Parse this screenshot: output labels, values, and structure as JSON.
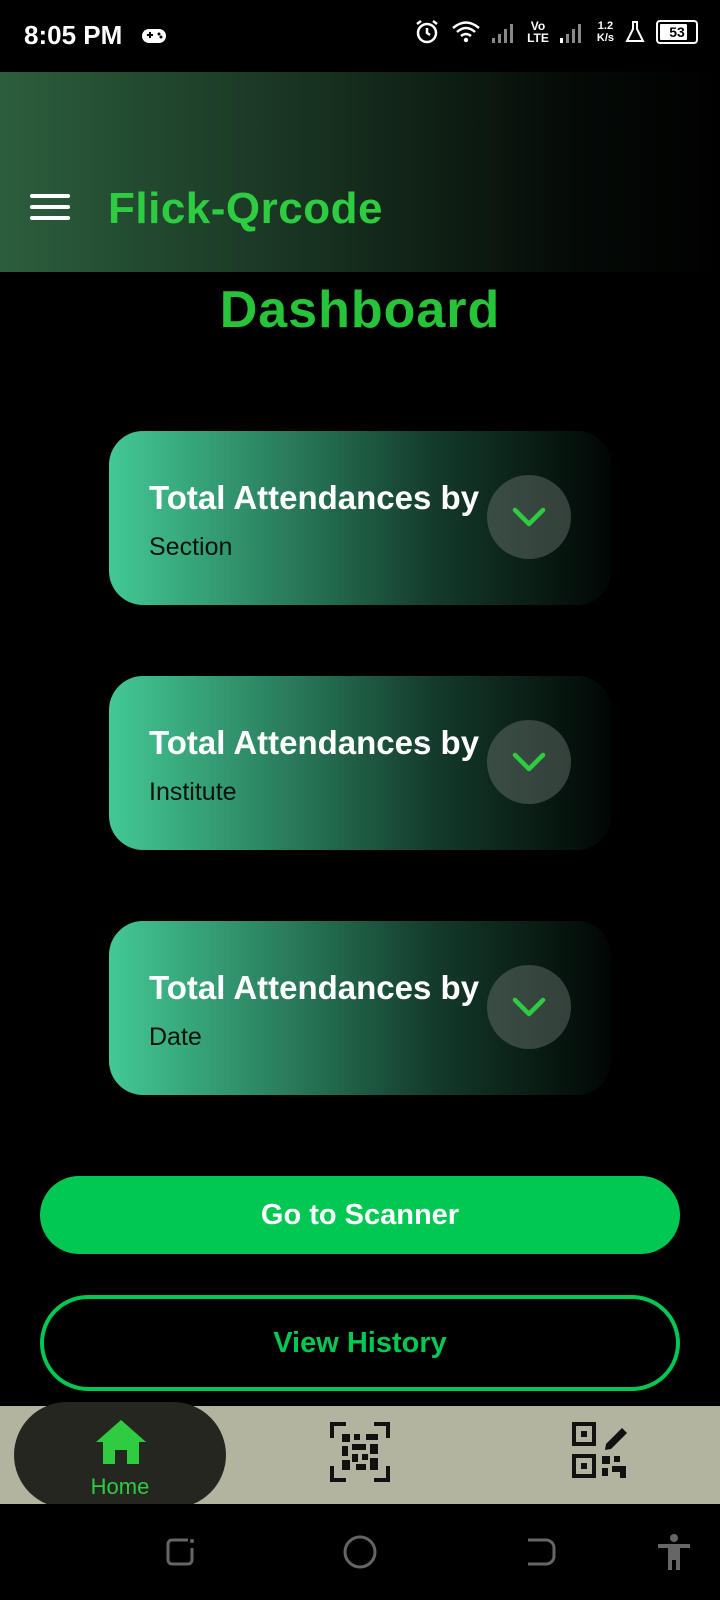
{
  "status_bar": {
    "time": "8:05 PM",
    "lte_top": "Vo",
    "lte_bottom": "LTE",
    "speed_value": "1.2",
    "speed_unit": "K/s",
    "battery": "53"
  },
  "app_bar": {
    "title": "Flick-Qrcode",
    "menu_icon": "hamburger-menu-icon"
  },
  "page": {
    "title": "Dashboard"
  },
  "cards": [
    {
      "title": "Total Attendances by",
      "subtitle": "Section"
    },
    {
      "title": "Total Attendances by",
      "subtitle": "Institute"
    },
    {
      "title": "Total Attendances by",
      "subtitle": "Date"
    }
  ],
  "buttons": {
    "scanner": "Go to Scanner",
    "history": "View History"
  },
  "bottom_nav": {
    "home_label": "Home",
    "items": [
      "home-icon",
      "qr-scanner-icon",
      "qr-generate-icon"
    ]
  },
  "colors": {
    "accent": "#2ecc40",
    "button_green": "#00c853",
    "nav_bg": "#b3b4a0",
    "nav_active_bg": "#252620"
  }
}
